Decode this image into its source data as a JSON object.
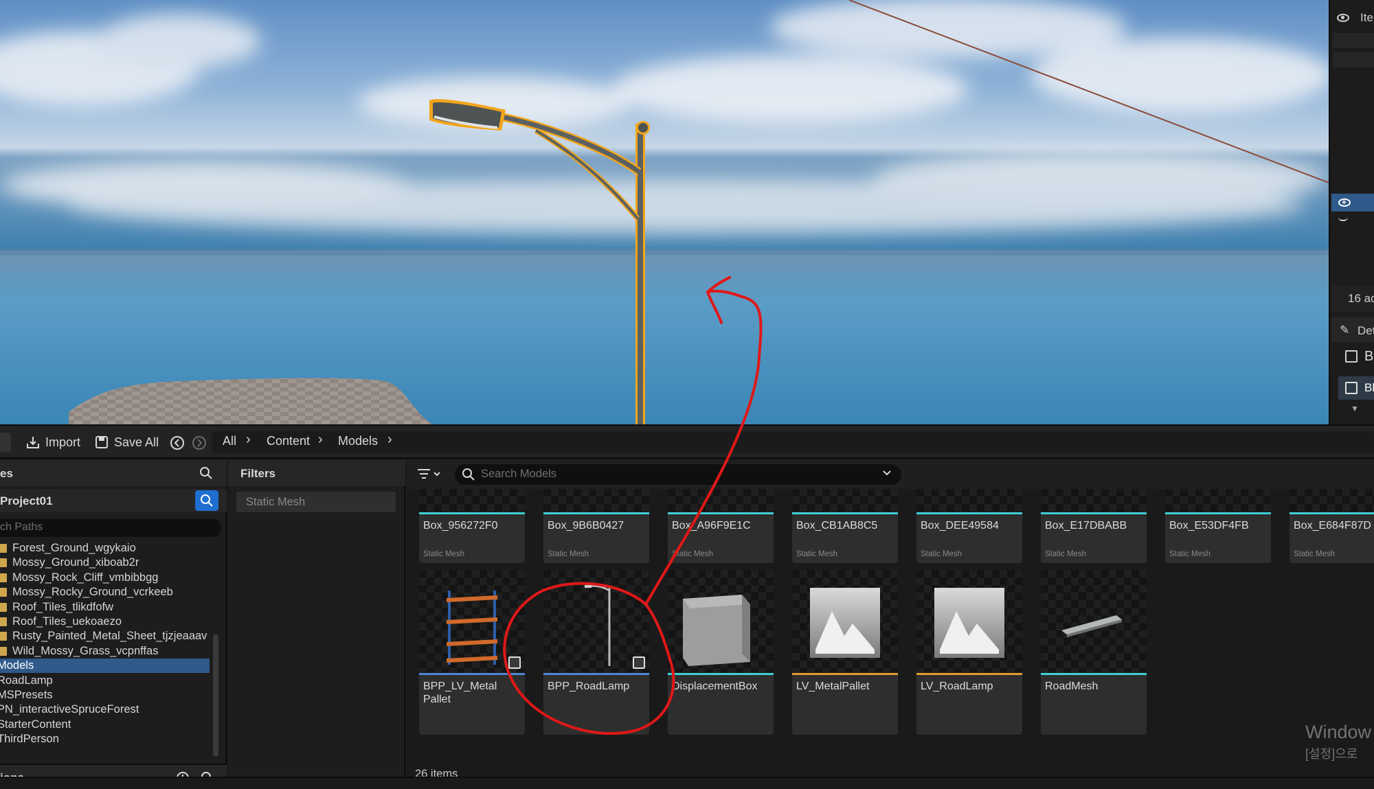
{
  "colors": {
    "accent": "#1f6fd1",
    "selection": "#2f5a8a",
    "static_mesh_bar": "#3fd0d8",
    "blueprint_bar": "#4f86d6",
    "texture_bar": "#e49a2e",
    "annotation": "#e01818",
    "selection_outline": "#f3a51c"
  },
  "right_strip": {
    "item_label": "Ite",
    "count_label": "16 ac",
    "details_label": "Det",
    "row_b1": "B",
    "row_b2": "Bl"
  },
  "toolbar": {
    "import_label": "Import",
    "save_all_label": "Save All",
    "breadcrumbs": [
      "All",
      "Content",
      "Models"
    ]
  },
  "sources": {
    "header": "es",
    "project": "Project01",
    "path_search_placeholder": "ch Paths",
    "tree": [
      {
        "label": "Forest_Ground_wgykaio",
        "folder": true,
        "selected": false
      },
      {
        "label": "Mossy_Ground_xiboab2r",
        "folder": true,
        "selected": false
      },
      {
        "label": "Mossy_Rock_Cliff_vmbibbgg",
        "folder": true,
        "selected": false
      },
      {
        "label": "Mossy_Rocky_Ground_vcrkeeb",
        "folder": true,
        "selected": false
      },
      {
        "label": "Roof_Tiles_tlikdfofw",
        "folder": true,
        "selected": false
      },
      {
        "label": "Roof_Tiles_uekoaezo",
        "folder": true,
        "selected": false
      },
      {
        "label": "Rusty_Painted_Metal_Sheet_tjzjeaaav",
        "folder": true,
        "selected": false
      },
      {
        "label": "Wild_Mossy_Grass_vcpnffas",
        "folder": true,
        "selected": false
      },
      {
        "label": "Models",
        "folder": false,
        "selected": true
      },
      {
        "label": "RoadLamp",
        "folder": false,
        "selected": false
      },
      {
        "label": "MSPresets",
        "folder": false,
        "selected": false
      },
      {
        "label": "PN_interactiveSpruceForest",
        "folder": false,
        "selected": false
      },
      {
        "label": "StarterContent",
        "folder": false,
        "selected": false
      },
      {
        "label": "ThirdPerson",
        "folder": false,
        "selected": false
      }
    ],
    "collections_header": "ions"
  },
  "filters": {
    "header": "Filters",
    "chip": "Static Mesh"
  },
  "assets": {
    "search_placeholder": "Search Models",
    "row1": [
      {
        "name": "Box_956272F0",
        "type": "Static Mesh"
      },
      {
        "name": "Box_9B6B0427",
        "type": "Static Mesh"
      },
      {
        "name": "Box_A96F9E1C",
        "type": "Static Mesh"
      },
      {
        "name": "Box_CB1AB8C5",
        "type": "Static Mesh"
      },
      {
        "name": "Box_DEE49584",
        "type": "Static Mesh"
      },
      {
        "name": "Box_E17DBABB",
        "type": "Static Mesh"
      },
      {
        "name": "Box_E53DF4FB",
        "type": "Static Mesh"
      },
      {
        "name": "Box_E684F87D",
        "type": "Static Mesh"
      }
    ],
    "row2": [
      {
        "name": "BPP_LV_Metal\nPallet",
        "kind": "blueprint",
        "thumb": "pallet"
      },
      {
        "name": "BPP_RoadLamp",
        "kind": "blueprint",
        "thumb": "lamp"
      },
      {
        "name": "DisplacementBox",
        "kind": "mesh",
        "thumb": "box"
      },
      {
        "name": "LV_MetalPallet",
        "kind": "texture",
        "thumb": "mountain"
      },
      {
        "name": "LV_RoadLamp",
        "kind": "texture",
        "thumb": "mountain"
      },
      {
        "name": "RoadMesh",
        "kind": "mesh",
        "thumb": "plank"
      }
    ],
    "item_count": "26 items"
  },
  "watermark": {
    "line1": "Window",
    "line2": "[설정]으로"
  }
}
